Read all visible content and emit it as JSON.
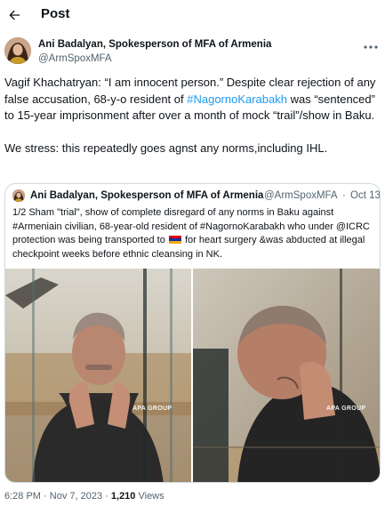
{
  "header": {
    "title": "Post",
    "back_icon": "arrow-left-icon"
  },
  "author": {
    "name": "Ani Badalyan, Spokesperson of MFA of Armenia",
    "handle": "@ArmSpoxMFA",
    "more_icon": "more-horizontal-icon"
  },
  "tweet": {
    "p1_a": "Vagif Khachatryan: “I am innocent person.” Despite clear rejection of any false accusation, 68-y-o resident of ",
    "p1_hashtag": "#NagornoKarabakh",
    "p1_b": " was “sentenced” to 15-year imprisonment after over a month of mock “trail”/show in Baku.",
    "p2": "We stress: this repeatedly goes agnst any norms,including IHL."
  },
  "quote": {
    "name": "Ani Badalyan, Spokesperson of MFA of Armenia",
    "handle": "@ArmSpoxMFA",
    "separator": "·",
    "date": "Oct 13",
    "text_a": "1/2 Sham \"trial\", show of complete disregard of any norms in Baku against #Armeniain civilian, 68-year-old resident of #NagornoKarabakh who under @ICRC protection was being transported to",
    "text_b": " for heart surgery &was abducted at illegal checkpoint weeks before ethnic cleansing in NK.",
    "flag_colors": [
      "#d90012",
      "#0033a0",
      "#f2a800"
    ],
    "watermark_left": "APA GROUP",
    "watermark_right": "APA GROUP"
  },
  "meta": {
    "time": "6:28 PM",
    "dot1": "·",
    "date": "Nov 7, 2023",
    "dot2": "·",
    "views_count": "1,210",
    "views_label": "Views"
  }
}
